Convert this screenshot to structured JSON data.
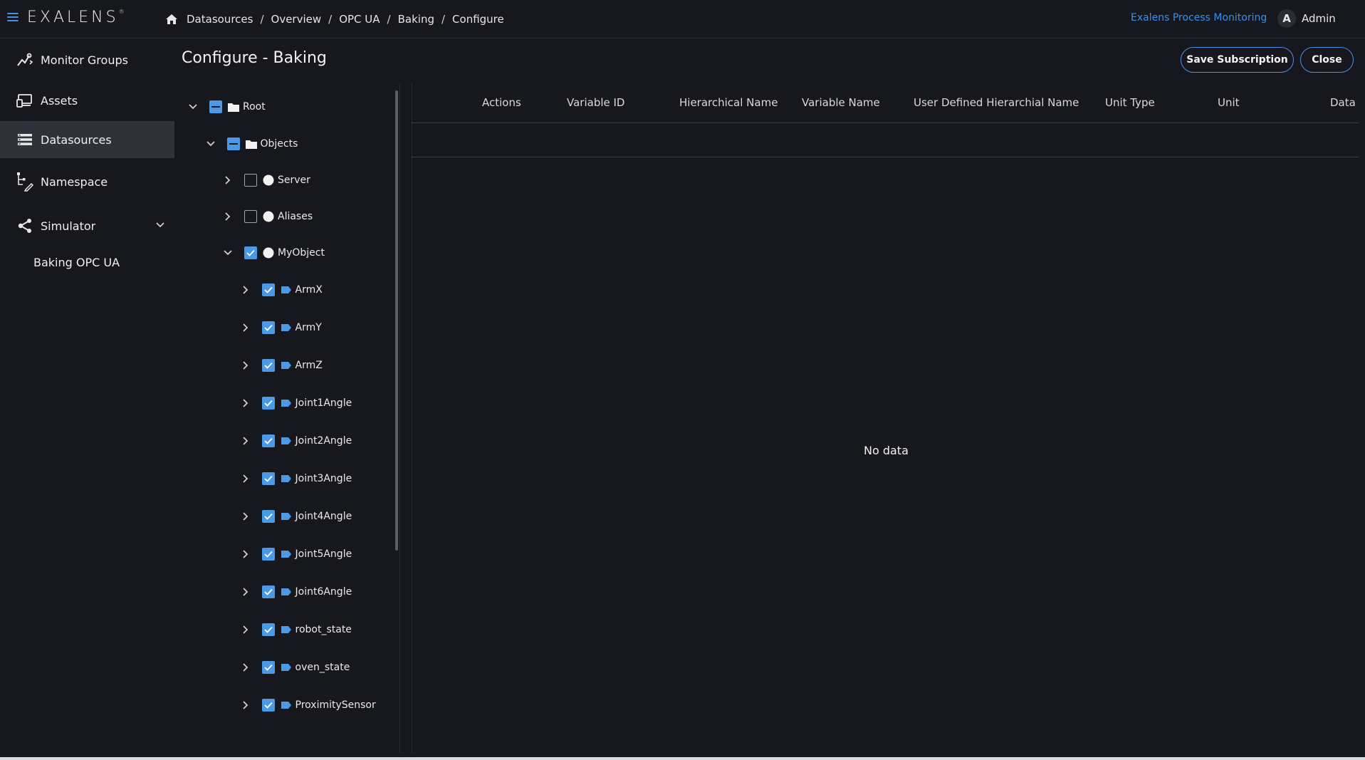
{
  "brand": {
    "logo": "EXALENS",
    "logo_mark": "®"
  },
  "breadcrumb": [
    "Datasources",
    "Overview",
    "OPC UA",
    "Baking",
    "Configure"
  ],
  "breadcrumb_sep": "/",
  "header": {
    "app_link": "Exalens Process Monitoring",
    "user_initial": "A",
    "user_name": "Admin"
  },
  "sidebar": {
    "items": [
      {
        "label": "Monitor Groups",
        "icon": "monitor-groups-icon"
      },
      {
        "label": "Assets",
        "icon": "assets-icon"
      },
      {
        "label": "Datasources",
        "icon": "datasources-icon",
        "active": true
      },
      {
        "label": "Namespace",
        "icon": "namespace-icon"
      },
      {
        "label": "Simulator",
        "icon": "simulator-icon",
        "expanded": true
      }
    ],
    "sub_items": [
      "Baking OPC UA"
    ]
  },
  "page": {
    "title": "Configure - Baking",
    "save_label": "Save Subscription",
    "close_label": "Close"
  },
  "tree": [
    {
      "label": "Root",
      "depth": 0,
      "expanded": true,
      "state": "partial",
      "icon": "folder-icon"
    },
    {
      "label": "Objects",
      "depth": 1,
      "expanded": true,
      "state": "partial",
      "icon": "folder-icon"
    },
    {
      "label": "Server",
      "depth": 2,
      "expanded": false,
      "state": "unchecked",
      "icon": "object-node-icon"
    },
    {
      "label": "Aliases",
      "depth": 2,
      "expanded": false,
      "state": "unchecked",
      "icon": "object-node-icon"
    },
    {
      "label": "MyObject",
      "depth": 2,
      "expanded": true,
      "state": "checked",
      "icon": "object-node-icon"
    },
    {
      "label": "ArmX",
      "depth": 3,
      "expanded": false,
      "state": "checked",
      "icon": "variable-tag-icon"
    },
    {
      "label": "ArmY",
      "depth": 3,
      "expanded": false,
      "state": "checked",
      "icon": "variable-tag-icon"
    },
    {
      "label": "ArmZ",
      "depth": 3,
      "expanded": false,
      "state": "checked",
      "icon": "variable-tag-icon"
    },
    {
      "label": "Joint1Angle",
      "depth": 3,
      "expanded": false,
      "state": "checked",
      "icon": "variable-tag-icon"
    },
    {
      "label": "Joint2Angle",
      "depth": 3,
      "expanded": false,
      "state": "checked",
      "icon": "variable-tag-icon"
    },
    {
      "label": "Joint3Angle",
      "depth": 3,
      "expanded": false,
      "state": "checked",
      "icon": "variable-tag-icon"
    },
    {
      "label": "Joint4Angle",
      "depth": 3,
      "expanded": false,
      "state": "checked",
      "icon": "variable-tag-icon"
    },
    {
      "label": "Joint5Angle",
      "depth": 3,
      "expanded": false,
      "state": "checked",
      "icon": "variable-tag-icon"
    },
    {
      "label": "Joint6Angle",
      "depth": 3,
      "expanded": false,
      "state": "checked",
      "icon": "variable-tag-icon"
    },
    {
      "label": "robot_state",
      "depth": 3,
      "expanded": false,
      "state": "checked",
      "icon": "variable-tag-icon"
    },
    {
      "label": "oven_state",
      "depth": 3,
      "expanded": false,
      "state": "checked",
      "icon": "variable-tag-icon"
    },
    {
      "label": "ProximitySensor",
      "depth": 3,
      "expanded": false,
      "state": "checked",
      "icon": "variable-tag-icon"
    }
  ],
  "table": {
    "columns": [
      "Actions",
      "Variable ID",
      "Hierarchical Name",
      "Variable Name",
      "User Defined Hierarchial Name",
      "Unit Type",
      "Unit",
      "Data"
    ],
    "empty_text": "No data"
  },
  "colors": {
    "accent": "#4d8fe0",
    "link": "#3b8eea",
    "background": "#16181d",
    "active_nav": "#2f3239"
  }
}
